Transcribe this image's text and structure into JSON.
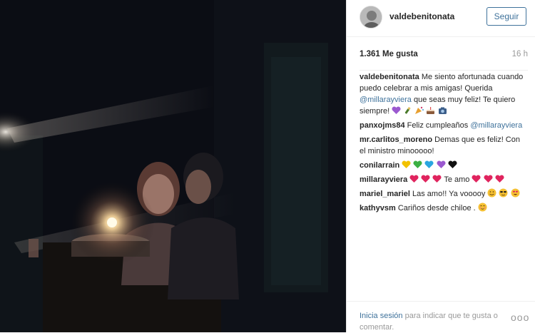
{
  "post": {
    "username": "valdebenitonata",
    "follow_label": "Seguir",
    "likes": "1.361 Me gusta",
    "time": "16 h"
  },
  "comments": [
    {
      "user": "valdebenitonata",
      "text_1": "Me siento afortunada cuando puedo celebrar a mis amigas! Querida",
      "mention": "@millarayviera",
      "text_2": "que seas muy feliz! Te quiero siempre!",
      "emojis": [
        "purple-heart",
        "champagne",
        "party-popper",
        "cake",
        "camera"
      ]
    },
    {
      "user": "panxojms84",
      "text_1": "Feliz cumpleaños",
      "mention": "@millarayviera"
    },
    {
      "user": "mr.carlitos_moreno",
      "text_1": "Demas que es feliz! Con el ministro minooooo!"
    },
    {
      "user": "conilarrain",
      "emojis": [
        "yellow-heart",
        "green-heart",
        "blue-heart",
        "purple-heart",
        "black-heart"
      ]
    },
    {
      "user": "millarayviera",
      "text_1": "Te amo",
      "emojis_before": [
        "red-heart",
        "red-heart",
        "red-heart"
      ],
      "emojis_after": [
        "red-heart",
        "red-heart",
        "red-heart"
      ]
    },
    {
      "user": "mariel_mariel",
      "text_1": "Las amo!! Ya vooooy",
      "emojis": [
        "smile-face",
        "sunglasses-face",
        "heart-eyes-face"
      ]
    },
    {
      "user": "kathyvsm",
      "text_1": "Cariños desde chiloe .",
      "emojis": [
        "blush-face"
      ]
    }
  ],
  "footer": {
    "login_label": "Inicia sesión",
    "rest_text": "para indicar que te gusta o comentar.",
    "more_label": "ooo"
  },
  "colors": {
    "link": "#3f729b",
    "muted": "#999999",
    "red_heart": "#e0245e"
  }
}
